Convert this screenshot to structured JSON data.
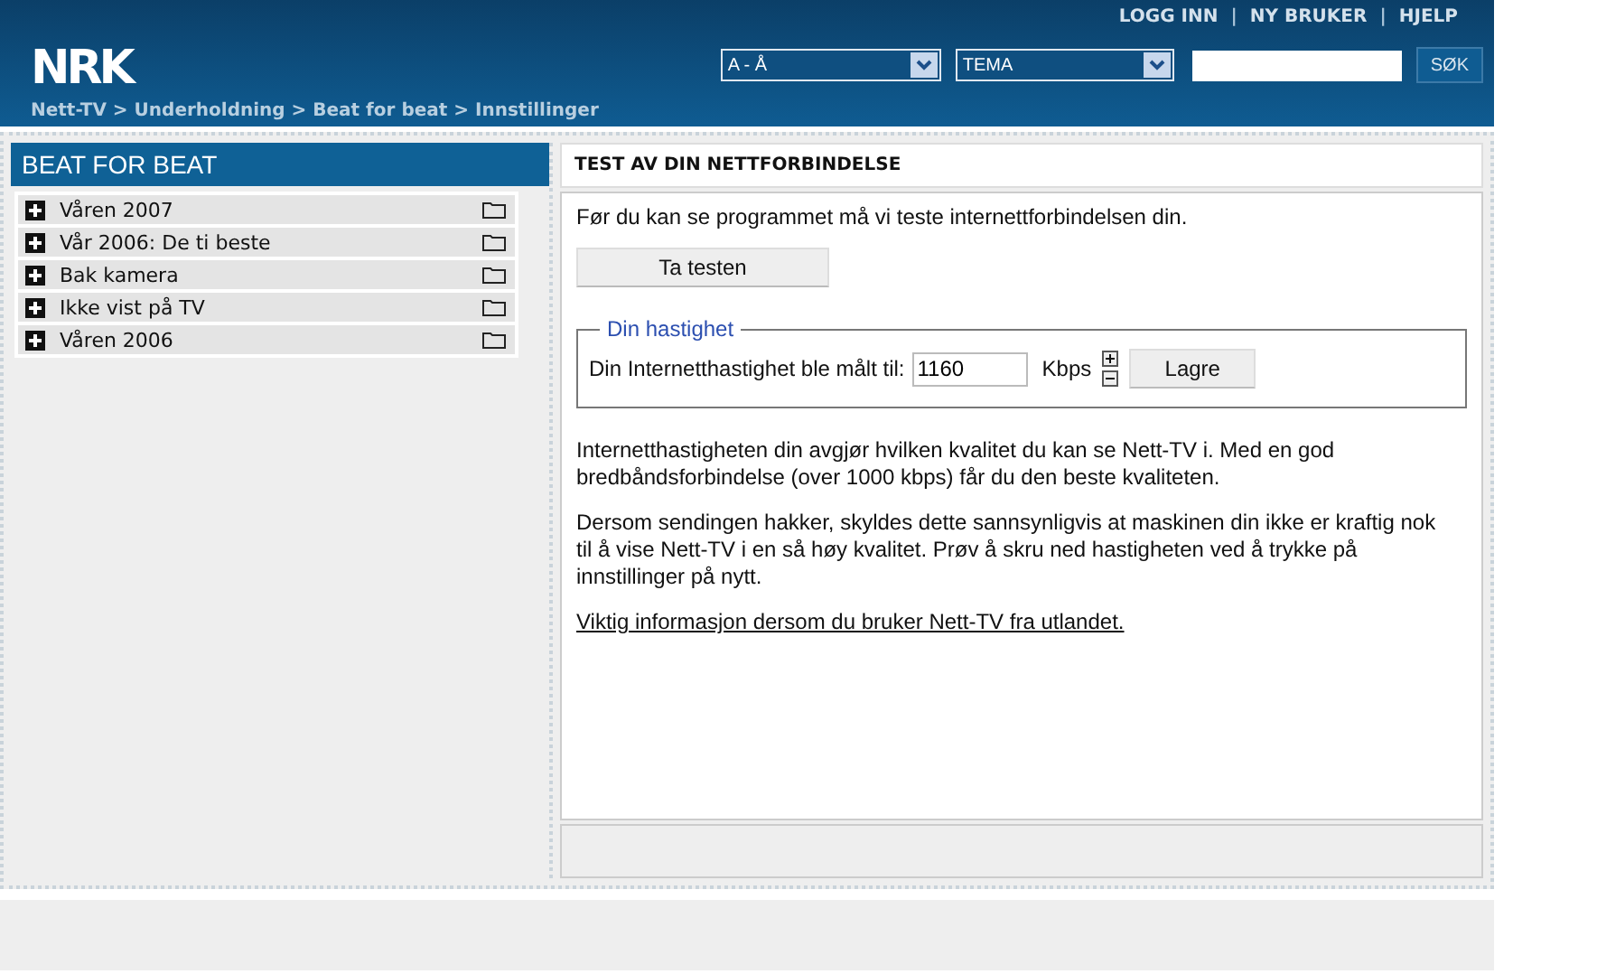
{
  "header": {
    "logo": "NRK",
    "top_links": [
      "LOGG INN",
      "NY BRUKER",
      "HJELP"
    ],
    "link_separator": "|",
    "breadcrumb": "Nett-TV > Underholdning > Beat for beat > Innstillinger",
    "selects": [
      {
        "value": "A - Å"
      },
      {
        "value": "TEMA"
      }
    ],
    "search_button": "SØK"
  },
  "sidebar": {
    "title": "BEAT FOR BEAT",
    "items": [
      {
        "label": "Våren 2007",
        "expanded": false
      },
      {
        "label": "Vår 2006: De ti beste",
        "expanded": false
      },
      {
        "label": "Bak kamera",
        "expanded": false
      },
      {
        "label": "Ikke vist på TV",
        "expanded": false
      },
      {
        "label": "Våren 2006",
        "expanded": false
      }
    ]
  },
  "main": {
    "title": "TEST AV DIN NETTFORBINDELSE",
    "intro": "Før du kan se programmet må vi teste internettforbindelsen din.",
    "test_button": "Ta testen",
    "speed": {
      "legend": "Din hastighet",
      "label": "Din Internetthastighet ble målt til:",
      "value": "1160",
      "unit": "Kbps",
      "save_button": "Lagre"
    },
    "paragraphs": [
      "Internetthastigheten din avgjør hvilken kvalitet du kan se Nett-TV i. Med en god bredbåndsforbindelse (over 1000 kbps) får du den beste kvaliteten.",
      "Dersom sendingen hakker, skyldes dette sannsynligvis at maskinen din ikke er kraftig nok til å vise Nett-TV i en så høy kvalitet. Prøv å skru ned hastigheten ved å trykke på innstillinger på nytt."
    ],
    "link": "Viktig informasjon dersom du bruker Nett-TV fra utlandet."
  }
}
